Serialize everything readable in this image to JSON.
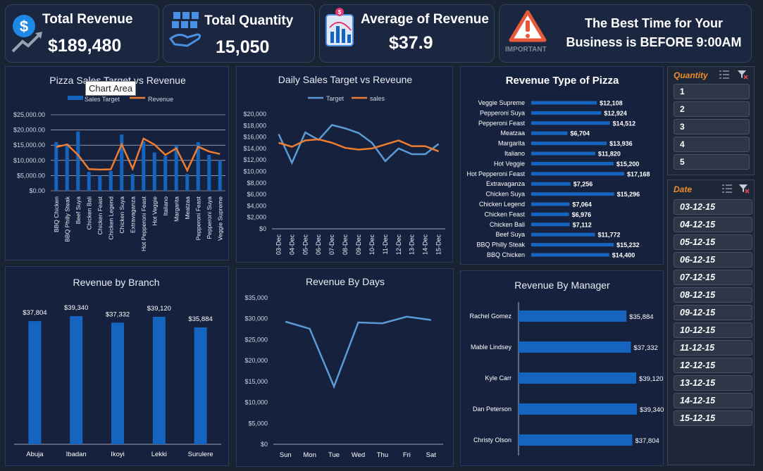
{
  "kpis": {
    "revenue": {
      "title": "Total Revenue",
      "value": "$189,480",
      "icon": "dollar-growth-icon"
    },
    "quantity": {
      "title": "Total Quantity",
      "value": "15,050",
      "icon": "boxes-hand-icon"
    },
    "average": {
      "title": "Average of Revenue",
      "value": "$37.9",
      "icon": "bar-chart-icon"
    },
    "best_time": {
      "line1": "The Best Time for Your",
      "line2": "Business is BEFORE 9:00AM",
      "badge": "IMPORTANT",
      "icon": "warning-icon"
    }
  },
  "tooltip": "Chart Area",
  "colors": {
    "bar": "#1565c0",
    "orange": "#ed7d31",
    "light_blue": "#5b9bd5",
    "bg": "#1a2332"
  },
  "slicers": {
    "quantity": {
      "header": "Quantity",
      "items": [
        "1",
        "2",
        "3",
        "4",
        "5"
      ]
    },
    "date": {
      "header": "Date",
      "items": [
        "03-12-15",
        "04-12-15",
        "05-12-15",
        "06-12-15",
        "07-12-15",
        "08-12-15",
        "09-12-15",
        "10-12-15",
        "11-12-15",
        "12-12-15",
        "13-12-15",
        "14-12-15",
        "15-12-15"
      ]
    }
  },
  "chart_data": [
    {
      "id": "pizza_target_revenue",
      "type": "bar",
      "title": "Pizza Sales Target vs Revenue",
      "legend": [
        "Sales Target",
        "Revenue"
      ],
      "legend_position": "top",
      "yticks": [
        "$0.00",
        "$5,000.00",
        "$10,000.00",
        "$15,000.00",
        "$20,000.00",
        "$25,000.00"
      ],
      "ylim": [
        0,
        25000
      ],
      "categories": [
        "BBQ Chicken",
        "BBQ Philly Steak",
        "Beef Suya",
        "Chicken Bali",
        "Chicken Feast",
        "Chicken Legend",
        "Chicken Suya",
        "Extravaganza",
        "Hot Pepperoni Feast",
        "Hot Veggie",
        "Italiano",
        "Margarita",
        "Meatzaa",
        "Pepperoni Feast",
        "Pepperoni Suya",
        "Veggie Supreme"
      ],
      "series": [
        {
          "name": "Sales Target",
          "type": "bar",
          "values": [
            16000,
            15500,
            19500,
            6200,
            5000,
            6500,
            18500,
            5500,
            16200,
            12600,
            11500,
            15000,
            5500,
            16000,
            11800,
            10000
          ]
        },
        {
          "name": "Revenue",
          "type": "line",
          "values": [
            14400,
            15232,
            11772,
            7112,
            6976,
            7064,
            15296,
            7256,
            17168,
            15200,
            11820,
            13936,
            6704,
            14512,
            12924,
            12108
          ]
        }
      ]
    },
    {
      "id": "daily_target_sales",
      "type": "line",
      "title": "Daily Sales Target vs Reveune",
      "legend": [
        "Target",
        "sales"
      ],
      "legend_position": "top",
      "yticks": [
        "$0",
        "$2,000",
        "$4,000",
        "$6,000",
        "$8,000",
        "$10,000",
        "$12,000",
        "$14,000",
        "$16,000",
        "$18,000",
        "$20,000"
      ],
      "ylim": [
        0,
        20000
      ],
      "categories": [
        "03-Dec",
        "04-Dec",
        "05-Dec",
        "06-Dec",
        "07-Dec",
        "08-Dec",
        "09-Dec",
        "10-Dec",
        "11-Dec",
        "12-Dec",
        "13-Dec",
        "14-Dec",
        "15-Dec"
      ],
      "series": [
        {
          "name": "Target",
          "values": [
            16500,
            11500,
            16800,
            15500,
            18100,
            17500,
            16700,
            15000,
            11800,
            14000,
            13000,
            13000,
            14800
          ]
        },
        {
          "name": "sales",
          "values": [
            15000,
            14300,
            15400,
            15600,
            15000,
            14100,
            13800,
            14000,
            14700,
            15400,
            14400,
            14400,
            13500
          ]
        }
      ]
    },
    {
      "id": "revenue_type",
      "type": "bar",
      "orientation": "horizontal",
      "title": "Revenue Type of Pizza",
      "categories": [
        "Veggie Supreme",
        "Pepperoni Suya",
        "Pepperoni Feast",
        "Meatzaa",
        "Margarita",
        "Italiano",
        "Hot Veggie",
        "Hot Pepperoni Feast",
        "Extravaganza",
        "Chicken Suya",
        "Chicken Legend",
        "Chicken Feast",
        "Chicken Bali",
        "Beef Suya",
        "BBQ Philly Steak",
        "BBQ Chicken"
      ],
      "values": [
        12108,
        12924,
        14512,
        6704,
        13936,
        11820,
        15200,
        17168,
        7256,
        15296,
        7064,
        6976,
        7112,
        11772,
        15232,
        14400
      ],
      "labels": [
        "$12,108",
        "$12,924",
        "$14,512",
        "$6,704",
        "$13,936",
        "$11,820",
        "$15,200",
        "$17,168",
        "$7,256",
        "$15,296",
        "$7,064",
        "$6,976",
        "$7,112",
        "$11,772",
        "$15,232",
        "$14,400"
      ]
    },
    {
      "id": "revenue_branch",
      "type": "bar",
      "title": "Revenue by Branch",
      "categories": [
        "Abuja",
        "Ibadan",
        "Ikoyi",
        "Lekki",
        "Surulere"
      ],
      "values": [
        37804,
        39340,
        37332,
        39120,
        35884
      ],
      "labels": [
        "$37,804",
        "$39,340",
        "$37,332",
        "$39,120",
        "$35,884"
      ]
    },
    {
      "id": "revenue_days",
      "type": "line",
      "title": "Revenue By Days",
      "yticks": [
        "$0",
        "$5,000",
        "$10,000",
        "$15,000",
        "$20,000",
        "$25,000",
        "$30,000",
        "$35,000"
      ],
      "ylim": [
        0,
        35000
      ],
      "categories": [
        "Sun",
        "Mon",
        "Tue",
        "Wed",
        "Thu",
        "Fri",
        "Sat"
      ],
      "values": [
        29300,
        27600,
        13800,
        29100,
        28900,
        30500,
        29700
      ]
    },
    {
      "id": "revenue_manager",
      "type": "bar",
      "orientation": "horizontal",
      "title": "Revenue By Manager",
      "categories": [
        "Rachel Gomez",
        "Mable Lindsey",
        "Kyle Carr",
        "Dan Peterson",
        "Christy Olson"
      ],
      "values": [
        35884,
        37332,
        39120,
        39340,
        37804
      ],
      "labels": [
        "$35,884",
        "$37,332",
        "$39,120",
        "$39,340",
        "$37,804"
      ]
    }
  ]
}
